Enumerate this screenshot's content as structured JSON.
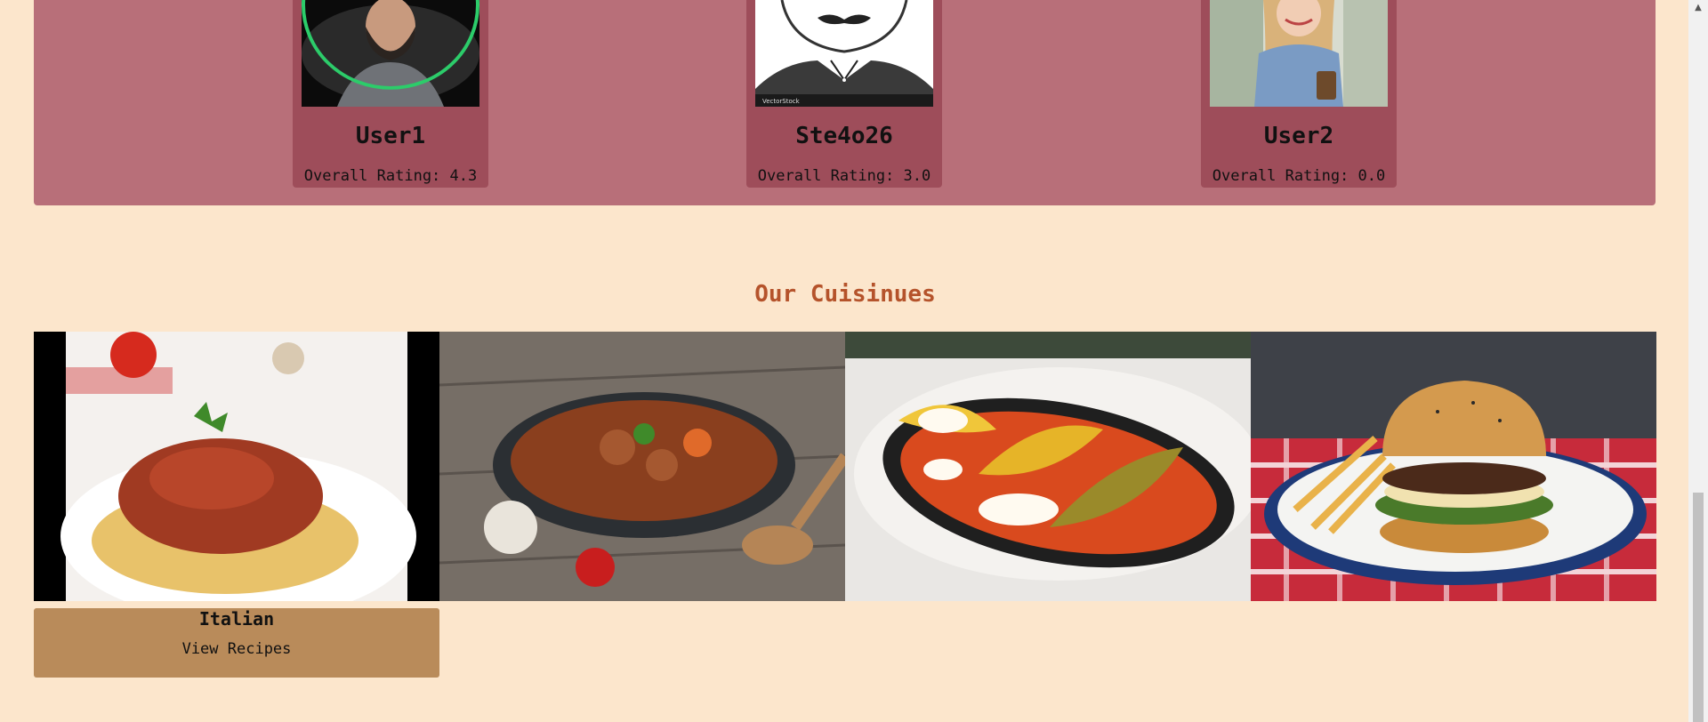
{
  "users": [
    {
      "name": "User1",
      "rating_label": "Overall Rating: 4.3",
      "avatar_icon": "user-photo-icon"
    },
    {
      "name": "Ste4o26",
      "rating_label": "Overall Rating: 3.0",
      "avatar_icon": "mustache-cartoon-icon",
      "watermark": "VectorStock"
    },
    {
      "name": "User2",
      "rating_label": "Overall Rating: 0.0",
      "avatar_icon": "user-selfie-icon"
    }
  ],
  "cuisines_section": {
    "title": "Our Cuisinues",
    "items": [
      {
        "name": "Italian",
        "link_label": "View Recipes",
        "image_icon": "spaghetti-bolognese-icon"
      },
      {
        "image_icon": "stew-pan-icon"
      },
      {
        "image_icon": "stuffed-peppers-icon"
      },
      {
        "image_icon": "burger-fries-icon"
      }
    ]
  },
  "colors": {
    "page_bg": "#fce6cc",
    "users_band": "#b86f79",
    "user_card": "#9e4d5a",
    "section_title": "#b5532b",
    "caption_bg": "#b98b5a"
  }
}
